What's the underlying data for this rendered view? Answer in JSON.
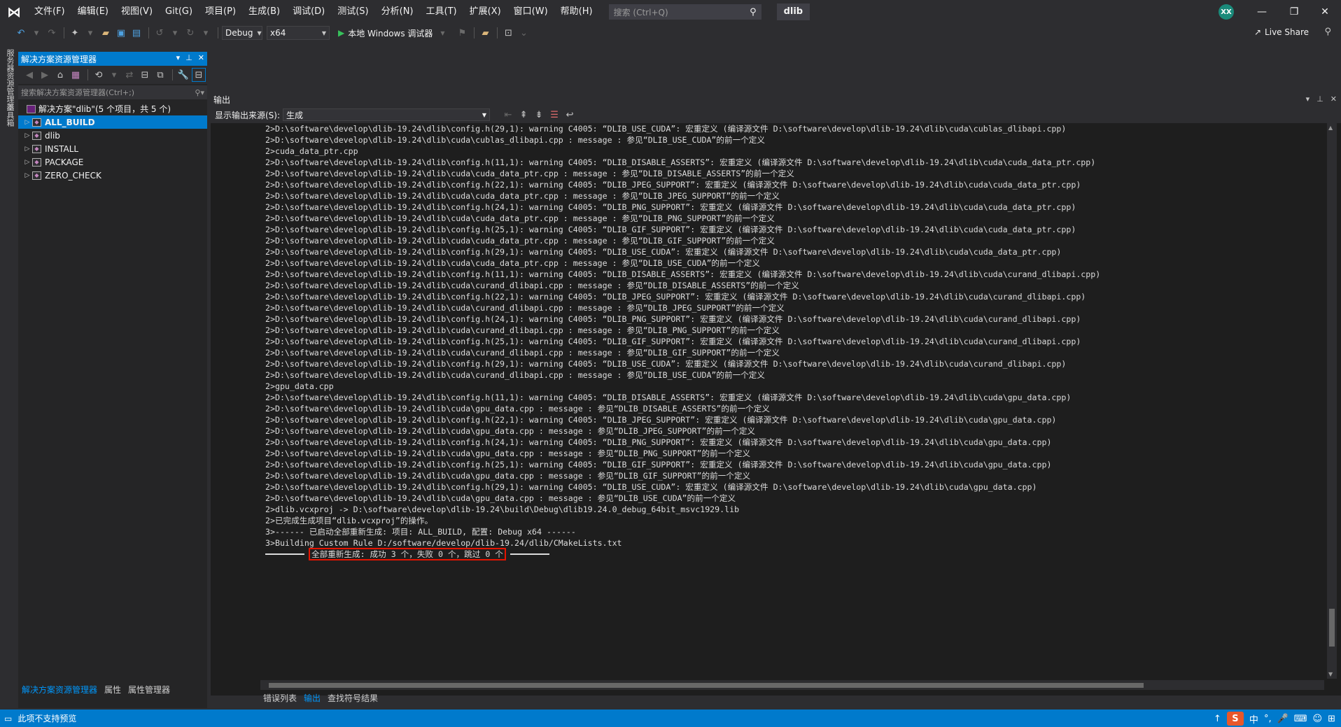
{
  "titlebar": {
    "menus": [
      "文件(F)",
      "编辑(E)",
      "视图(V)",
      "Git(G)",
      "项目(P)",
      "生成(B)",
      "调试(D)",
      "测试(S)",
      "分析(N)",
      "工具(T)",
      "扩展(X)",
      "窗口(W)",
      "帮助(H)"
    ],
    "search_placeholder": "搜索 (Ctrl+Q)",
    "solution_name": "dlib",
    "avatar_initials": "XX"
  },
  "toolbar": {
    "config": "Debug",
    "platform": "x64",
    "run_label": "本地 Windows 调试器",
    "live_share": "Live Share"
  },
  "left_strip": {
    "tab1": "服务器资源管理器",
    "tab2": "工具箱"
  },
  "solution_explorer": {
    "title": "解决方案资源管理器",
    "search_placeholder": "搜索解决方案资源管理器(Ctrl+;)",
    "solution_label": "解决方案\"dlib\"(5 个项目，共 5 个)",
    "projects": [
      "ALL_BUILD",
      "dlib",
      "INSTALL",
      "PACKAGE",
      "ZERO_CHECK"
    ],
    "selected_index": 0,
    "bottom_tabs": [
      "解决方案资源管理器",
      "属性",
      "属性管理器"
    ]
  },
  "output": {
    "title": "输出",
    "source_label": "显示输出来源(S):",
    "source_value": "生成",
    "lines": [
      "2>D:\\software\\develop\\dlib-19.24\\dlib\\config.h(29,1): warning C4005: “DLIB_USE_CUDA”: 宏重定义 (编译源文件 D:\\software\\develop\\dlib-19.24\\dlib\\cuda\\cublas_dlibapi.cpp)",
      "2>D:\\software\\develop\\dlib-19.24\\dlib\\cuda\\cublas_dlibapi.cpp : message : 参见“DLIB_USE_CUDA”的前一个定义",
      "2>cuda_data_ptr.cpp",
      "2>D:\\software\\develop\\dlib-19.24\\dlib\\config.h(11,1): warning C4005: “DLIB_DISABLE_ASSERTS”: 宏重定义 (编译源文件 D:\\software\\develop\\dlib-19.24\\dlib\\cuda\\cuda_data_ptr.cpp)",
      "2>D:\\software\\develop\\dlib-19.24\\dlib\\cuda\\cuda_data_ptr.cpp : message : 参见“DLIB_DISABLE_ASSERTS”的前一个定义",
      "2>D:\\software\\develop\\dlib-19.24\\dlib\\config.h(22,1): warning C4005: “DLIB_JPEG_SUPPORT”: 宏重定义 (编译源文件 D:\\software\\develop\\dlib-19.24\\dlib\\cuda\\cuda_data_ptr.cpp)",
      "2>D:\\software\\develop\\dlib-19.24\\dlib\\cuda\\cuda_data_ptr.cpp : message : 参见“DLIB_JPEG_SUPPORT”的前一个定义",
      "2>D:\\software\\develop\\dlib-19.24\\dlib\\config.h(24,1): warning C4005: “DLIB_PNG_SUPPORT”: 宏重定义 (编译源文件 D:\\software\\develop\\dlib-19.24\\dlib\\cuda\\cuda_data_ptr.cpp)",
      "2>D:\\software\\develop\\dlib-19.24\\dlib\\cuda\\cuda_data_ptr.cpp : message : 参见“DLIB_PNG_SUPPORT”的前一个定义",
      "2>D:\\software\\develop\\dlib-19.24\\dlib\\config.h(25,1): warning C4005: “DLIB_GIF_SUPPORT”: 宏重定义 (编译源文件 D:\\software\\develop\\dlib-19.24\\dlib\\cuda\\cuda_data_ptr.cpp)",
      "2>D:\\software\\develop\\dlib-19.24\\dlib\\cuda\\cuda_data_ptr.cpp : message : 参见“DLIB_GIF_SUPPORT”的前一个定义",
      "2>D:\\software\\develop\\dlib-19.24\\dlib\\config.h(29,1): warning C4005: “DLIB_USE_CUDA”: 宏重定义 (编译源文件 D:\\software\\develop\\dlib-19.24\\dlib\\cuda\\cuda_data_ptr.cpp)",
      "2>D:\\software\\develop\\dlib-19.24\\dlib\\cuda\\cuda_data_ptr.cpp : message : 参见“DLIB_USE_CUDA”的前一个定义",
      "2>D:\\software\\develop\\dlib-19.24\\dlib\\config.h(11,1): warning C4005: “DLIB_DISABLE_ASSERTS”: 宏重定义 (编译源文件 D:\\software\\develop\\dlib-19.24\\dlib\\cuda\\curand_dlibapi.cpp)",
      "2>D:\\software\\develop\\dlib-19.24\\dlib\\cuda\\curand_dlibapi.cpp : message : 参见“DLIB_DISABLE_ASSERTS”的前一个定义",
      "2>D:\\software\\develop\\dlib-19.24\\dlib\\config.h(22,1): warning C4005: “DLIB_JPEG_SUPPORT”: 宏重定义 (编译源文件 D:\\software\\develop\\dlib-19.24\\dlib\\cuda\\curand_dlibapi.cpp)",
      "2>D:\\software\\develop\\dlib-19.24\\dlib\\cuda\\curand_dlibapi.cpp : message : 参见“DLIB_JPEG_SUPPORT”的前一个定义",
      "2>D:\\software\\develop\\dlib-19.24\\dlib\\config.h(24,1): warning C4005: “DLIB_PNG_SUPPORT”: 宏重定义 (编译源文件 D:\\software\\develop\\dlib-19.24\\dlib\\cuda\\curand_dlibapi.cpp)",
      "2>D:\\software\\develop\\dlib-19.24\\dlib\\cuda\\curand_dlibapi.cpp : message : 参见“DLIB_PNG_SUPPORT”的前一个定义",
      "2>D:\\software\\develop\\dlib-19.24\\dlib\\config.h(25,1): warning C4005: “DLIB_GIF_SUPPORT”: 宏重定义 (编译源文件 D:\\software\\develop\\dlib-19.24\\dlib\\cuda\\curand_dlibapi.cpp)",
      "2>D:\\software\\develop\\dlib-19.24\\dlib\\cuda\\curand_dlibapi.cpp : message : 参见“DLIB_GIF_SUPPORT”的前一个定义",
      "2>D:\\software\\develop\\dlib-19.24\\dlib\\config.h(29,1): warning C4005: “DLIB_USE_CUDA”: 宏重定义 (编译源文件 D:\\software\\develop\\dlib-19.24\\dlib\\cuda\\curand_dlibapi.cpp)",
      "2>D:\\software\\develop\\dlib-19.24\\dlib\\cuda\\curand_dlibapi.cpp : message : 参见“DLIB_USE_CUDA”的前一个定义",
      "2>gpu_data.cpp",
      "2>D:\\software\\develop\\dlib-19.24\\dlib\\config.h(11,1): warning C4005: “DLIB_DISABLE_ASSERTS”: 宏重定义 (编译源文件 D:\\software\\develop\\dlib-19.24\\dlib\\cuda\\gpu_data.cpp)",
      "2>D:\\software\\develop\\dlib-19.24\\dlib\\cuda\\gpu_data.cpp : message : 参见“DLIB_DISABLE_ASSERTS”的前一个定义",
      "2>D:\\software\\develop\\dlib-19.24\\dlib\\config.h(22,1): warning C4005: “DLIB_JPEG_SUPPORT”: 宏重定义 (编译源文件 D:\\software\\develop\\dlib-19.24\\dlib\\cuda\\gpu_data.cpp)",
      "2>D:\\software\\develop\\dlib-19.24\\dlib\\cuda\\gpu_data.cpp : message : 参见“DLIB_JPEG_SUPPORT”的前一个定义",
      "2>D:\\software\\develop\\dlib-19.24\\dlib\\config.h(24,1): warning C4005: “DLIB_PNG_SUPPORT”: 宏重定义 (编译源文件 D:\\software\\develop\\dlib-19.24\\dlib\\cuda\\gpu_data.cpp)",
      "2>D:\\software\\develop\\dlib-19.24\\dlib\\cuda\\gpu_data.cpp : message : 参见“DLIB_PNG_SUPPORT”的前一个定义",
      "2>D:\\software\\develop\\dlib-19.24\\dlib\\config.h(25,1): warning C4005: “DLIB_GIF_SUPPORT”: 宏重定义 (编译源文件 D:\\software\\develop\\dlib-19.24\\dlib\\cuda\\gpu_data.cpp)",
      "2>D:\\software\\develop\\dlib-19.24\\dlib\\cuda\\gpu_data.cpp : message : 参见“DLIB_GIF_SUPPORT”的前一个定义",
      "2>D:\\software\\develop\\dlib-19.24\\dlib\\config.h(29,1): warning C4005: “DLIB_USE_CUDA”: 宏重定义 (编译源文件 D:\\software\\develop\\dlib-19.24\\dlib\\cuda\\gpu_data.cpp)",
      "2>D:\\software\\develop\\dlib-19.24\\dlib\\cuda\\gpu_data.cpp : message : 参见“DLIB_USE_CUDA”的前一个定义",
      "2>dlib.vcxproj -> D:\\software\\develop\\dlib-19.24\\build\\Debug\\dlib19.24.0_debug_64bit_msvc1929.lib",
      "2>已完成生成项目“dlib.vcxproj”的操作。",
      "3>------ 已启动全部重新生成: 项目: ALL_BUILD, 配置: Debug x64 ------",
      "3>Building Custom Rule D:/software/develop/dlib-19.24/dlib/CMakeLists.txt"
    ],
    "summary": "全部重新生成: 成功 3 个，失败 0 个，跳过 0 个",
    "bottom_tabs": [
      "错误列表",
      "输出",
      "查找符号结果"
    ],
    "active_tab_index": 1
  },
  "statusbar": {
    "text": "此项不支持预览",
    "ime_label": "S",
    "ime_lang": "中"
  },
  "colors": {
    "accent": "#007acc",
    "summary_border": "#e51400",
    "background": "#1e1e1e"
  }
}
